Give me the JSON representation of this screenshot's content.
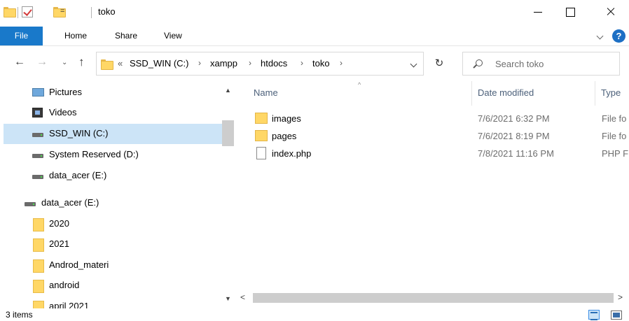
{
  "window": {
    "title": "toko",
    "quick_access_dropdown": "=",
    "buttons": {
      "minimize": "minimize",
      "maximize": "maximize",
      "close": "close"
    }
  },
  "ribbon": {
    "tabs": [
      "File",
      "Home",
      "Share",
      "View"
    ],
    "help_label": "?"
  },
  "address": {
    "overflow": "«",
    "crumbs": [
      "SSD_WIN (C:)",
      "xampp",
      "htdocs",
      "toko"
    ],
    "separator": "›"
  },
  "search": {
    "placeholder": "Search toko"
  },
  "nav_pane": {
    "items": [
      {
        "label": "Pictures",
        "icon": "pictures-icon"
      },
      {
        "label": "Videos",
        "icon": "videos-icon"
      },
      {
        "label": "SSD_WIN (C:)",
        "icon": "drive-icon",
        "selected": true
      },
      {
        "label": "System Reserved (D:)",
        "icon": "drive-icon"
      },
      {
        "label": "data_acer (E:)",
        "icon": "drive-icon"
      },
      {
        "label": "data_acer (E:)",
        "icon": "drive-icon"
      },
      {
        "label": "2020",
        "icon": "folder-icon"
      },
      {
        "label": "2021",
        "icon": "folder-icon"
      },
      {
        "label": "Androd_materi",
        "icon": "folder-icon"
      },
      {
        "label": "android",
        "icon": "folder-icon"
      },
      {
        "label": "april 2021",
        "icon": "folder-icon"
      }
    ]
  },
  "file_list": {
    "columns": {
      "name": "Name",
      "date": "Date modified",
      "type": "Type"
    },
    "rows": [
      {
        "name": "images",
        "date": "7/6/2021 6:32 PM",
        "type": "File fo",
        "icon": "folder-icon"
      },
      {
        "name": "pages",
        "date": "7/6/2021 8:19 PM",
        "type": "File fo",
        "icon": "folder-icon"
      },
      {
        "name": "index.php",
        "date": "7/8/2021 11:16 PM",
        "type": "PHP F",
        "icon": "document-icon"
      }
    ]
  },
  "status": {
    "item_count": "3 items"
  },
  "colors": {
    "accent": "#1979ca",
    "selection": "#cce4f7",
    "folder": "#ffd766"
  }
}
